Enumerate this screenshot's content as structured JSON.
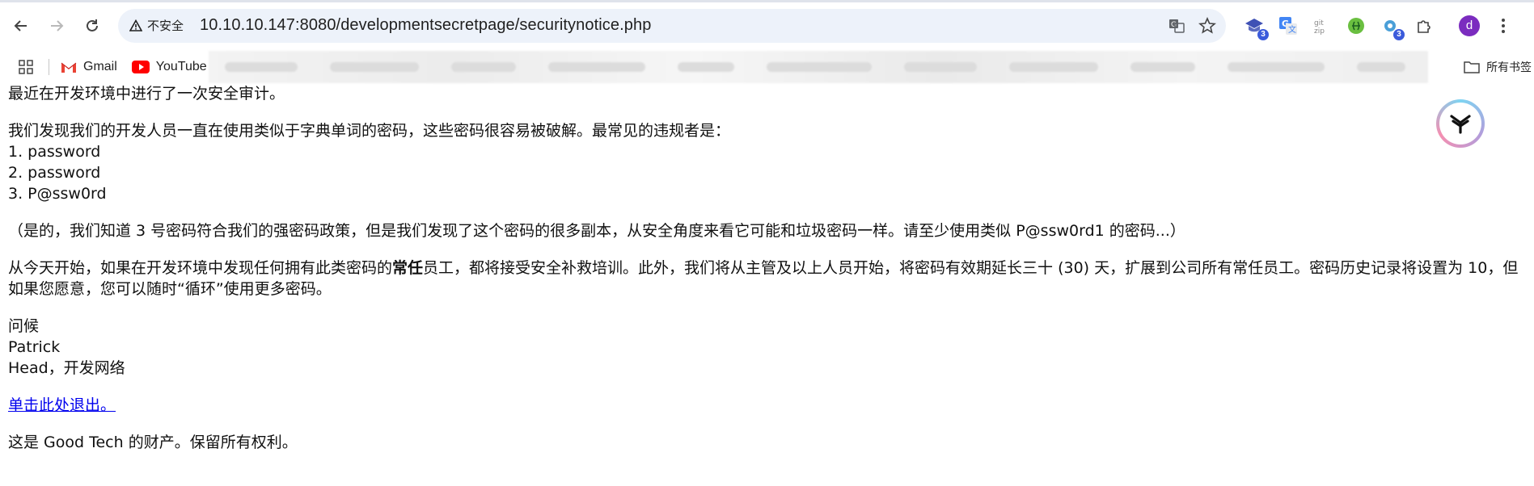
{
  "browser": {
    "security_label": "不安全",
    "url": "10.10.10.147:8080/developmentsecretpage/securitynotice.php",
    "extensions": [
      {
        "icon": "graduation-cap-extension-icon",
        "badge": "3"
      },
      {
        "icon": "translate-extension-icon",
        "badge": ""
      },
      {
        "icon": "gitzip-extension-icon",
        "badge": ""
      },
      {
        "icon": "green-circle-extension-icon",
        "badge": ""
      },
      {
        "icon": "gear-extension-icon",
        "badge": "3"
      }
    ],
    "profile_initial": "d",
    "bookmarks": [
      {
        "label": "Gmail",
        "icon": "gmail-icon"
      },
      {
        "label": "YouTube",
        "icon": "youtube-icon"
      }
    ],
    "all_bookmarks_label": "所有书签"
  },
  "page": {
    "intro": "最近在开发环境中进行了一次安全审计。",
    "finding": "我们发现我们的开发人员一直在使用类似于字典单词的密码，这些密码很容易被破解。最常见的违规者是：",
    "list": [
      "1. password",
      "2. password",
      "3. P@ssw0rd"
    ],
    "note": "（是的，我们知道 3 号密码符合我们的强密码政策，但是我们发现了这个密码的很多副本，从安全角度来看它可能和垃圾密码一样。请至少使用类似 P@ssw0rd1 的密码...）",
    "policy_before": "从今天开始，如果在开发环境中发现任何拥有此类密码的",
    "policy_bold": "常任",
    "policy_after": "员工，都将接受安全补救培训。此外，我们将从主管及以上人员开始，将密码有效期延长三十 (30) 天，扩展到公司所有常任员工。密码历史记录将设置为 10，但如果您愿意，您可以随时“循环”使用更多密码。",
    "signoff": "问候",
    "signer_name": "Patrick",
    "signer_title": "Head，开发网络",
    "logout_link": "单击此处退出。",
    "footer": "这是 Good Tech 的财产。保留所有权利。"
  }
}
